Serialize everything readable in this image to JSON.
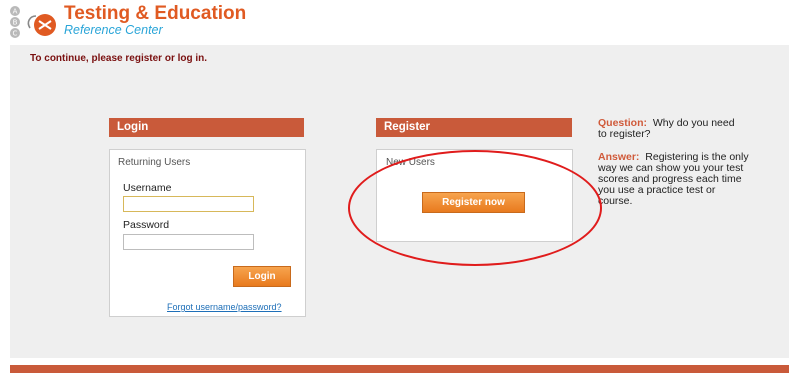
{
  "header": {
    "title": "Testing & Education",
    "subtitle": "Reference Center"
  },
  "notice": "To continue, please register or log in.",
  "login": {
    "heading": "Login",
    "section": "Returning Users",
    "username_label": "Username",
    "username_value": "",
    "password_label": "Password",
    "password_value": "",
    "button": "Login",
    "forgot_link": "Forgot username/password?"
  },
  "register": {
    "heading": "Register",
    "section": "New Users",
    "button": "Register now"
  },
  "faq": {
    "question_label": "Question:",
    "question_text": "Why do you need to register?",
    "answer_label": "Answer:",
    "answer_text": "Registering is the only way we can show you your test scores and progress each time you use a practice test or course."
  },
  "colors": {
    "accent": "#c95a3a",
    "brand_orange": "#e05a22",
    "brand_blue": "#2aa5d8",
    "annotation": "#e01c1c"
  }
}
